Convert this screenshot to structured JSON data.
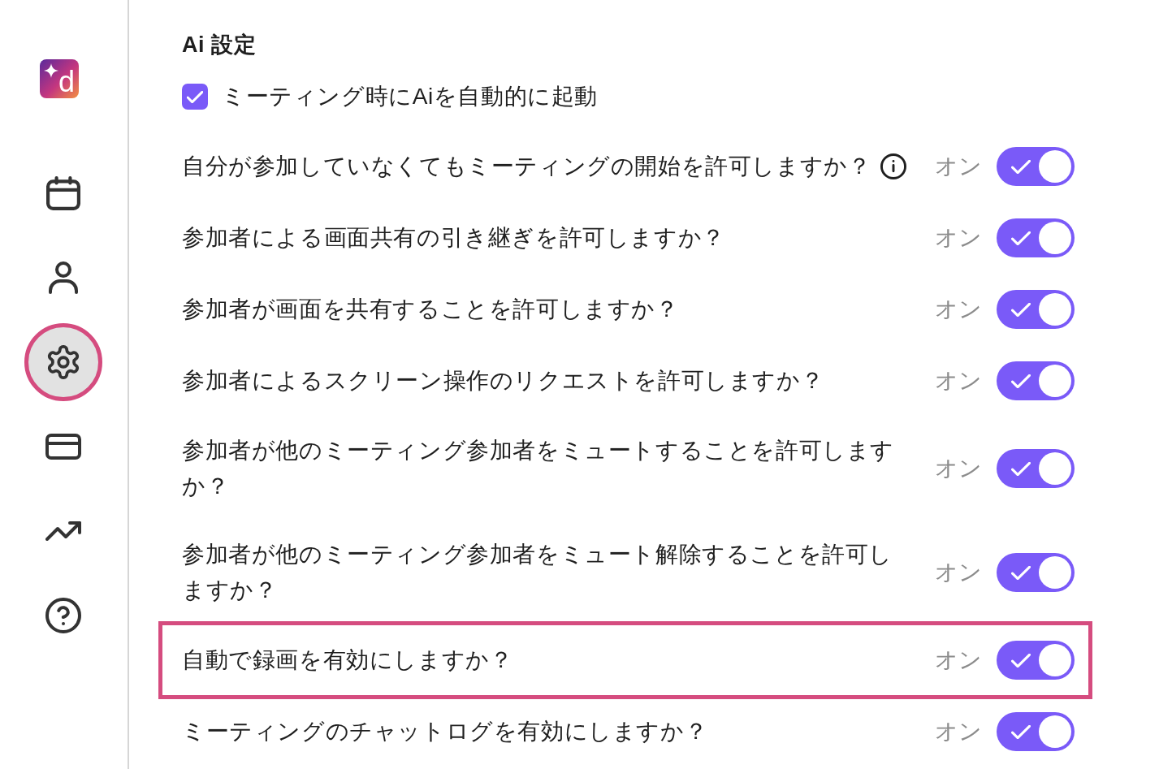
{
  "sidebar": {
    "logo": {
      "letter": "d"
    },
    "items": [
      {
        "kind": "calendar",
        "selected": false,
        "highlighted": false
      },
      {
        "kind": "person",
        "selected": false,
        "highlighted": false
      },
      {
        "kind": "settings",
        "selected": true,
        "highlighted": true
      },
      {
        "kind": "card",
        "selected": false,
        "highlighted": false
      },
      {
        "kind": "trend",
        "selected": false,
        "highlighted": false
      },
      {
        "kind": "help",
        "selected": false,
        "highlighted": false
      }
    ]
  },
  "section": {
    "title": "Ai 設定",
    "ai_autostart": {
      "label": "ミーティング時にAiを自動的に起動",
      "checked": true
    },
    "rows": [
      {
        "label": "自分が参加していなくてもミーティングの開始を許可しますか？",
        "info": true,
        "status": "オン",
        "on": true,
        "highlighted": false
      },
      {
        "label": "参加者による画面共有の引き継ぎを許可しますか？",
        "info": false,
        "status": "オン",
        "on": true,
        "highlighted": false
      },
      {
        "label": "参加者が画面を共有することを許可しますか？",
        "info": false,
        "status": "オン",
        "on": true,
        "highlighted": false
      },
      {
        "label": "参加者によるスクリーン操作のリクエストを許可しますか？",
        "info": false,
        "status": "オン",
        "on": true,
        "highlighted": false
      },
      {
        "label": "参加者が他のミーティング参加者をミュートすることを許可しますか？",
        "info": false,
        "status": "オン",
        "on": true,
        "highlighted": false
      },
      {
        "label": "参加者が他のミーティング参加者をミュート解除することを許可しますか？",
        "info": false,
        "status": "オン",
        "on": true,
        "highlighted": false
      },
      {
        "label": "自動で録画を有効にしますか？",
        "info": false,
        "status": "オン",
        "on": true,
        "highlighted": true
      },
      {
        "label": "ミーティングのチャットログを有効にしますか？",
        "info": false,
        "status": "オン",
        "on": true,
        "highlighted": false
      }
    ]
  }
}
